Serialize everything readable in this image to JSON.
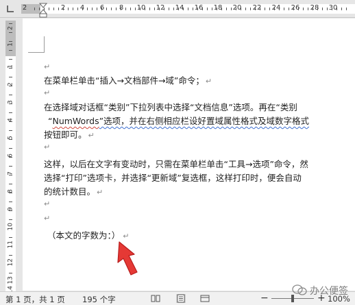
{
  "ruler": {
    "numbers": [
      "2",
      "2",
      "4",
      "6",
      "8",
      "10",
      "12",
      "14",
      "16",
      "18",
      "20",
      "22",
      "24",
      "26",
      "28",
      "30"
    ],
    "vnumbers": [
      "2",
      "1",
      "1",
      "2",
      "3",
      "4",
      "5",
      "6",
      "7",
      "8",
      "9",
      "10",
      "11",
      "12",
      "13",
      "14"
    ]
  },
  "document": {
    "line1": "在菜单栏单击“插入→文档部件→域”命令；",
    "line3": "在选择域对话框“类别”下拉列表中选择“文档信息”选项。再在“类别",
    "line4_pre": "“",
    "line4_word": "NumWords",
    "line4_post": "”选项，并在右侧相应栏设好置域属性格式及域数字格式",
    "line5": "按钮即可。",
    "line7": "这样，以后在文字有变动时，只需在菜单栏单击“工具→选项”命令，然",
    "line8": "选择“打印”选项卡，并选择“更新域”复选框，这样打印时，便会自动",
    "line9": "的统计数目。",
    "line11": "（本文的字数为：）",
    "para_mark": "↵"
  },
  "status": {
    "page": "第 1 页，共 1 页",
    "words": "195 个字",
    "zoom": "100%",
    "zoom_minus": "−",
    "zoom_plus": "+"
  },
  "watermark": {
    "text": "办公便签"
  }
}
